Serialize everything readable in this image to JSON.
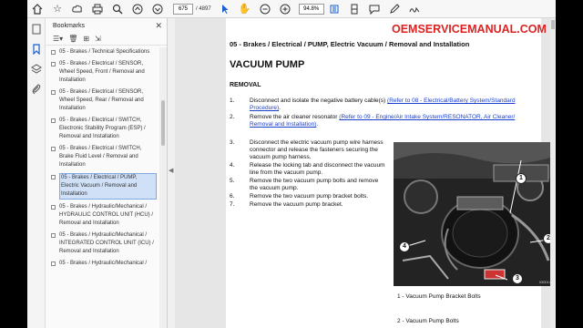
{
  "toolbar": {
    "page_current": "675",
    "page_total": "/ 4897",
    "zoom": "94.8%"
  },
  "sidebar": {
    "title": "Bookmarks",
    "items": [
      {
        "label": "05 - Brakes / Technical Specifications",
        "selected": false
      },
      {
        "label": "05 - Brakes / Electrical / SENSOR, Wheel Speed, Front / Removal and Installation",
        "selected": false
      },
      {
        "label": "05 - Brakes / Electrical / SENSOR, Wheel Speed, Rear / Removal and Installation",
        "selected": false
      },
      {
        "label": "05 - Brakes / Electrical / SWITCH, Electronic Stability Program (ESP) / Removal and Installation",
        "selected": false
      },
      {
        "label": "05 - Brakes / Electrical / SWITCH, Brake Fluid Level / Removal and Installation",
        "selected": false
      },
      {
        "label": "05 - Brakes / Electrical / PUMP, Electric Vacuum / Removal and Installation",
        "selected": true
      },
      {
        "label": "05 - Brakes / Hydraulic/Mechanical / HYDRAULIC CONTROL UNIT (HCU) / Removal and Installation",
        "selected": false
      },
      {
        "label": "05 - Brakes / Hydraulic/Mechanical / INTEGRATED CONTROL UNIT (ICU) / Removal and Installation",
        "selected": false
      },
      {
        "label": "05 - Brakes / Hydraulic/Mechanical /",
        "selected": false
      }
    ]
  },
  "document": {
    "title": "05 - Brakes / Electrical / PUMP, Electric Vacuum / Removal and Installation",
    "watermark": "OEMSERVICEMANUAL.COM",
    "heading": "VACUUM PUMP",
    "subheading": "REMOVAL",
    "steps_a": [
      {
        "num": "1.",
        "text": "Disconnect and isolate the negative battery cable(s) ",
        "link": "(Refer to 08 - Electrical/Battery System/Standard Procedure)",
        "tail": "."
      },
      {
        "num": "2.",
        "text": "Remove the air cleaner resonator ",
        "link": "(Refer to 09 - Engine/Air Intake System/RESONATOR, Air Cleaner/ Removal and Installation)",
        "tail": "."
      }
    ],
    "steps_b": [
      {
        "num": "3.",
        "text": "Disconnect the electric vacuum pump wire harness connector and release the fasteners securing the vacuum pump harness."
      },
      {
        "num": "4.",
        "text": "Release the locking tab and disconnect the vacuum line from the vacuum pump."
      },
      {
        "num": "5.",
        "text": "Remove the two vacuum pump bolts and remove the vacuum pump."
      },
      {
        "num": "6.",
        "text": "Remove the two vacuum pump bracket bolts."
      },
      {
        "num": "7.",
        "text": "Remove the vacuum pump bracket."
      }
    ],
    "figure": {
      "callouts": [
        "1",
        "2",
        "3",
        "4"
      ],
      "id": "0300148ab3"
    },
    "captions": [
      "1 - Vacuum Pump Bracket Bolts",
      "2 - Vacuum Pump Bolts"
    ]
  }
}
